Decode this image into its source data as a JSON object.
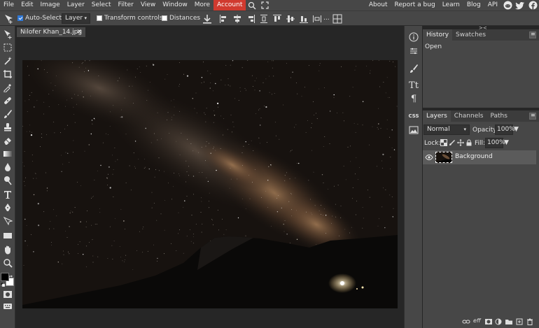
{
  "menu": {
    "items": [
      "File",
      "Edit",
      "Image",
      "Layer",
      "Select",
      "Filter",
      "View",
      "Window",
      "More",
      "Account"
    ],
    "right_links": [
      "About",
      "Report a bug",
      "Learn",
      "Blog",
      "API"
    ],
    "social_icons": [
      "reddit-icon",
      "twitter-icon",
      "facebook-icon"
    ]
  },
  "options": {
    "auto_select_label": "Auto-Select",
    "auto_select_checked": true,
    "select_mode": "Layer",
    "transform_controls_label": "Transform controls",
    "distances_label": "Distances",
    "more": "..."
  },
  "document": {
    "tab_title": "Nilofer Khan_14.jpg",
    "close": "✕"
  },
  "history_panel": {
    "tabs": [
      "History",
      "Swatches"
    ],
    "items": [
      "Open"
    ]
  },
  "layers_panel": {
    "tabs": [
      "Layers",
      "Channels",
      "Paths"
    ],
    "blend_mode": "Normal",
    "opacity_label": "Opacity:",
    "opacity_value": "100%",
    "lock_label": "Lock:",
    "fill_label": "Fill:",
    "fill_value": "100%",
    "layers": [
      {
        "name": "Background",
        "visible": true
      }
    ],
    "footer_labels": [
      "eff"
    ]
  },
  "side_strip": {
    "collapse_arrows": [
      "<>",
      "><"
    ],
    "css_label": "CSS"
  },
  "colors": {
    "accent": "#d03a2f",
    "menubar": "#474747",
    "workspace": "#262626",
    "selected_layer": "#5b5b5b",
    "foreground": "#000000",
    "background": "#ffffff"
  }
}
